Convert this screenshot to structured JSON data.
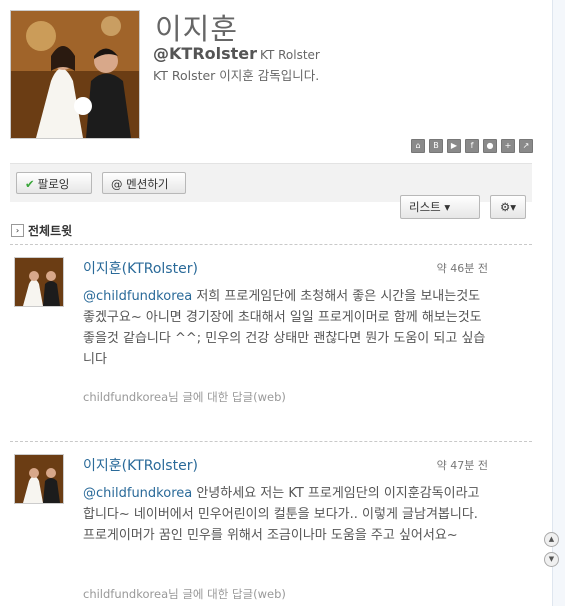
{
  "profile": {
    "name": "이지훈",
    "handle": "@KTRolster",
    "display_name": "KT Rolster",
    "bio": "KT Rolster 이지훈 감독입니다."
  },
  "social_icons": [
    "home-icon",
    "blog-icon",
    "youtube-icon",
    "facebook-icon",
    "me2day-icon",
    "plus-icon",
    "external-link-icon"
  ],
  "actions": {
    "follow_label": "팔로잉",
    "mention_label": "@ 멘션하기",
    "list_label": "리스트 ▾",
    "gear_label": "⚙▾"
  },
  "section": {
    "toggle_label": "전체트윗"
  },
  "tweets": [
    {
      "author": "이지훈(KTRolster)",
      "time": "약 46분 전",
      "mention": "@childfundkorea",
      "text": " 저희 프로게임단에 초청해서 좋은 시간을 보내는것도 좋겠구요~ 아니면 경기장에 초대해서 일일 프로게이머로 함께 해보는것도 좋을것 같습니다 ^^; 민우의 건강 상태만 괜찮다면 뭔가 도움이 되고 싶습니다",
      "meta": "childfundkorea님 글에 대한 답글(web)"
    },
    {
      "author": "이지훈(KTRolster)",
      "time": "약 47분 전",
      "mention": "@childfundkorea",
      "text": " 안녕하세요 저는 KT 프로게임단의 이지훈감독이라고 합니다~ 네이버에서 민우어린이의 컬툰을 보다가.. 이렇게 글남겨봅니다. 프로게이머가 꿈인 민우를 위해서 조금이나마 도움을 주고 싶어서요~",
      "meta": "childfundkorea님 글에 대한 답글(web)"
    }
  ],
  "colors": {
    "link": "#2a6a99",
    "check": "#3aa63a"
  }
}
